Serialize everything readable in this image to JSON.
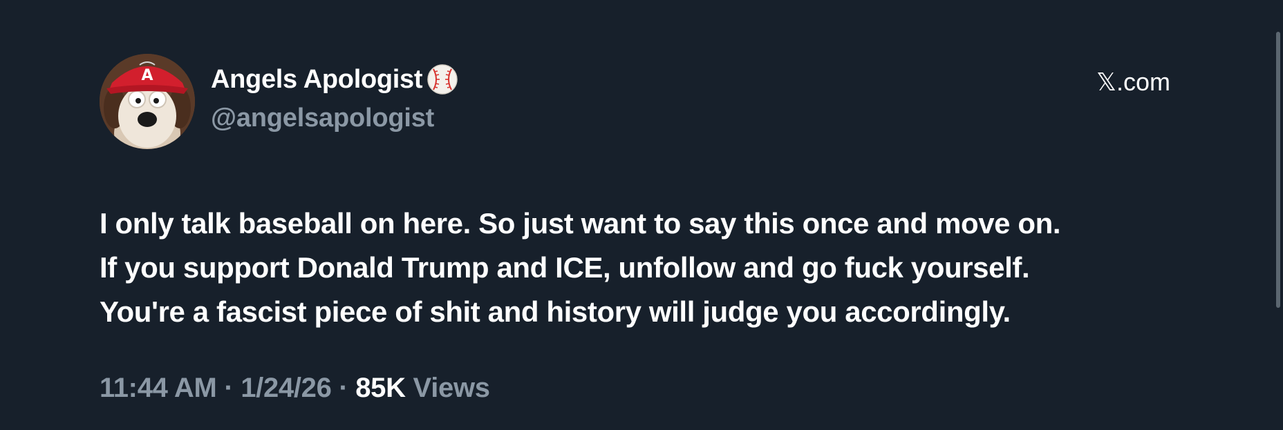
{
  "author": {
    "display_name": "Angels Apologist",
    "handle": "@angelsapologist",
    "badge_icon": "baseball-icon"
  },
  "source": {
    "label": "𝕏.com"
  },
  "tweet": {
    "lines": [
      "I only talk baseball on here. So just want to say this once and move on.",
      "If you support Donald Trump and ICE, unfollow and go fuck yourself.",
      "You're a fascist piece of shit and history will judge you accordingly."
    ]
  },
  "meta": {
    "time": "11:44 AM",
    "separator": " · ",
    "date": "1/24/26",
    "views_count": "85K",
    "views_label": "Views"
  },
  "colors": {
    "background": "#17202b",
    "primary_text": "#ffffff",
    "secondary_text": "#8b98a5"
  }
}
